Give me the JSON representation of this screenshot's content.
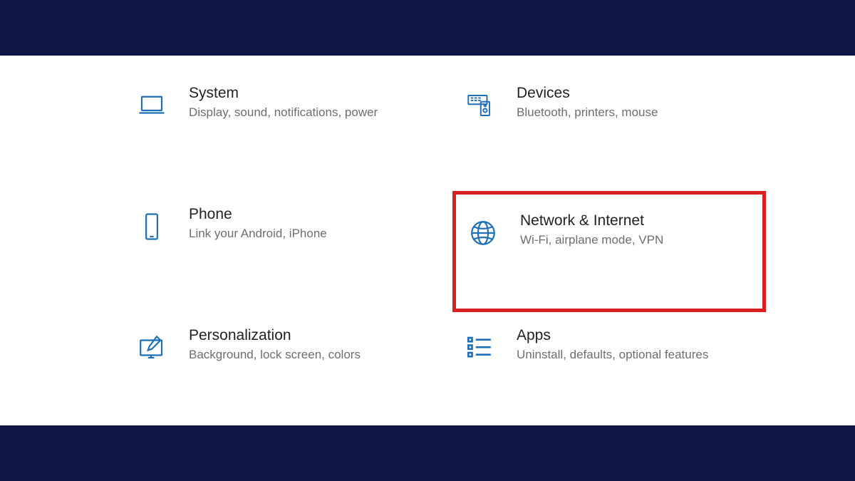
{
  "colors": {
    "iconBlue": "#1e6fb8",
    "highlightRed": "#d81f1f",
    "barNavy": "#0d1645"
  },
  "categories": [
    {
      "id": "system",
      "title": "System",
      "desc": "Display, sound, notifications, power",
      "icon": "laptop-icon",
      "highlighted": false
    },
    {
      "id": "devices",
      "title": "Devices",
      "desc": "Bluetooth, printers, mouse",
      "icon": "devices-icon",
      "highlighted": false
    },
    {
      "id": "phone",
      "title": "Phone",
      "desc": "Link your Android, iPhone",
      "icon": "phone-icon",
      "highlighted": false
    },
    {
      "id": "network",
      "title": "Network & Internet",
      "desc": "Wi-Fi, airplane mode, VPN",
      "icon": "globe-icon",
      "highlighted": true
    },
    {
      "id": "personalization",
      "title": "Personalization",
      "desc": "Background, lock screen, colors",
      "icon": "personalize-icon",
      "highlighted": false
    },
    {
      "id": "apps",
      "title": "Apps",
      "desc": "Uninstall, defaults, optional features",
      "icon": "apps-icon",
      "highlighted": false
    }
  ]
}
